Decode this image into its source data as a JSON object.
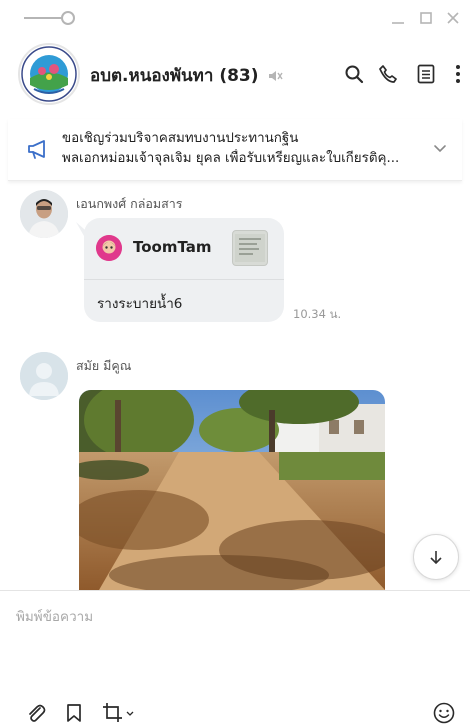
{
  "header": {
    "title": "อบต.หนองพันทา (83)",
    "member_count_note": "(83)"
  },
  "announcement": {
    "line1": "ขอเชิญร่วมบริจาคสมทบงานประทานกฐิน",
    "line2": "พลเอกหม่อมเจ้าจุลเจิม ยุคล เพื่อรับเหรียญและใบเกียรติคุ..."
  },
  "messages": [
    {
      "sender": "เอนกพงศ์ กล่อมสาร",
      "sticker_name": "ToomTam",
      "caption": "รางระบายน้ำ6",
      "time": "10.34 น."
    },
    {
      "sender": "สมัย มีคูณ"
    }
  ],
  "composer": {
    "placeholder": "พิมพ์ข้อความ"
  },
  "icons": {
    "mute": "speaker-muted-icon",
    "search": "search-icon",
    "call": "phone-icon",
    "notes": "notes-icon",
    "more": "more-vertical-icon",
    "announce": "megaphone-icon",
    "expand": "chevron-down-icon",
    "scroll": "arrow-down-icon",
    "attach": "paperclip-icon",
    "bookmark": "bookmark-icon",
    "crop": "crop-icon",
    "emoji": "emoji-icon"
  },
  "colors": {
    "accent": "#06c755",
    "bubble": "#eef0f2",
    "announce_icon": "#3b6fc9"
  }
}
